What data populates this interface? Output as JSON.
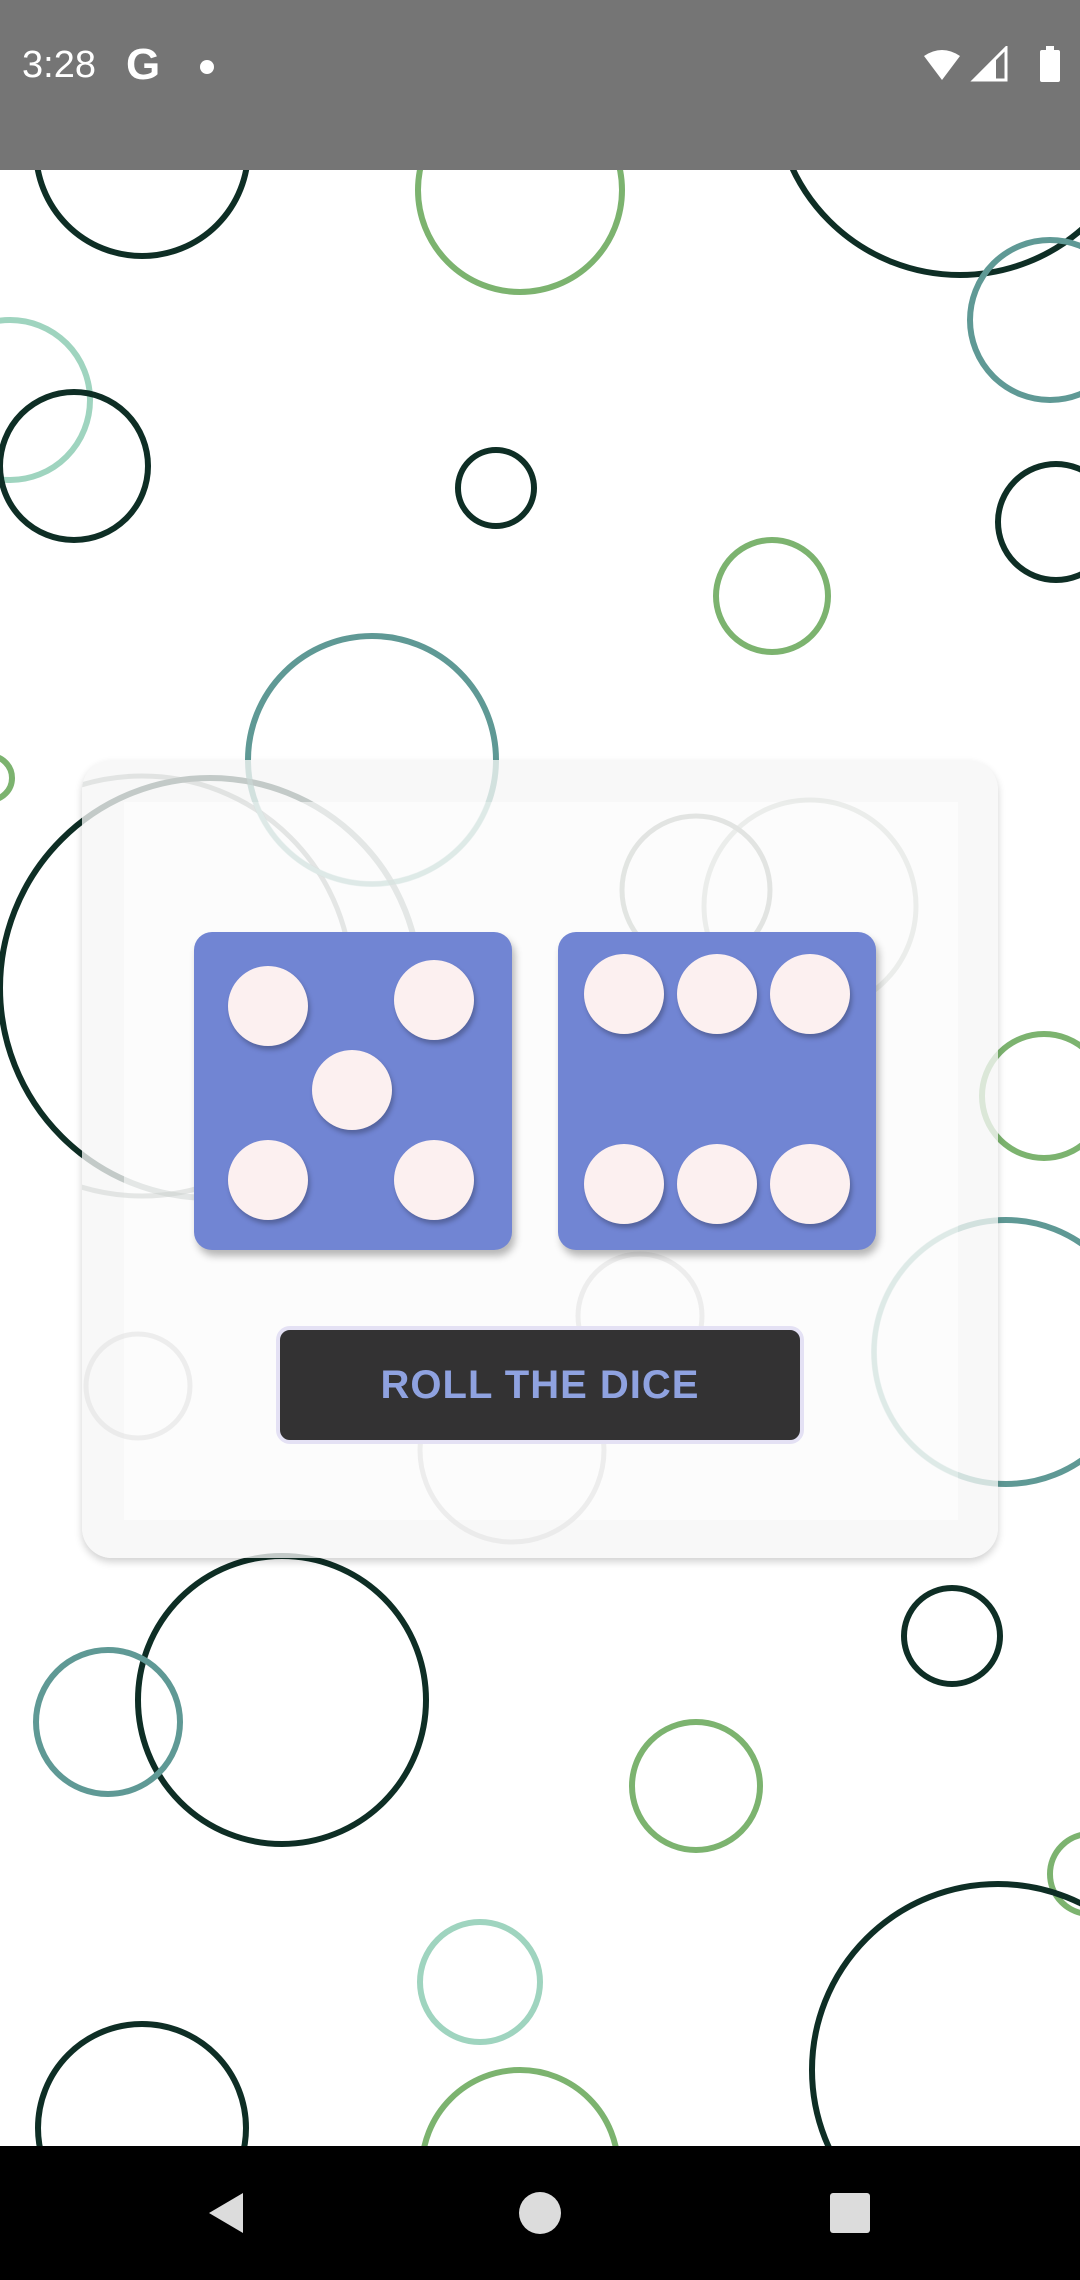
{
  "status_bar": {
    "time": "3:28",
    "google_icon": "G",
    "icons": [
      "wifi-icon",
      "signal-icon",
      "battery-icon"
    ]
  },
  "dice": [
    {
      "name": "die-left",
      "value": 5
    },
    {
      "name": "die-right",
      "value": 6
    }
  ],
  "roll_button": {
    "label": "ROLL THE DICE"
  },
  "nav_bar": {
    "icons": [
      "back-icon",
      "home-icon",
      "recents-icon"
    ]
  },
  "colors": {
    "die": "#7185d3",
    "pip": "#fcf0f0",
    "button_bg": "#333233",
    "button_text": "#8fa2e0",
    "bubble_dark": "#0e2e25",
    "bubble_green": "#7cb36f",
    "bubble_teal": "#5f9995",
    "bubble_mint": "#9fd4bf"
  }
}
